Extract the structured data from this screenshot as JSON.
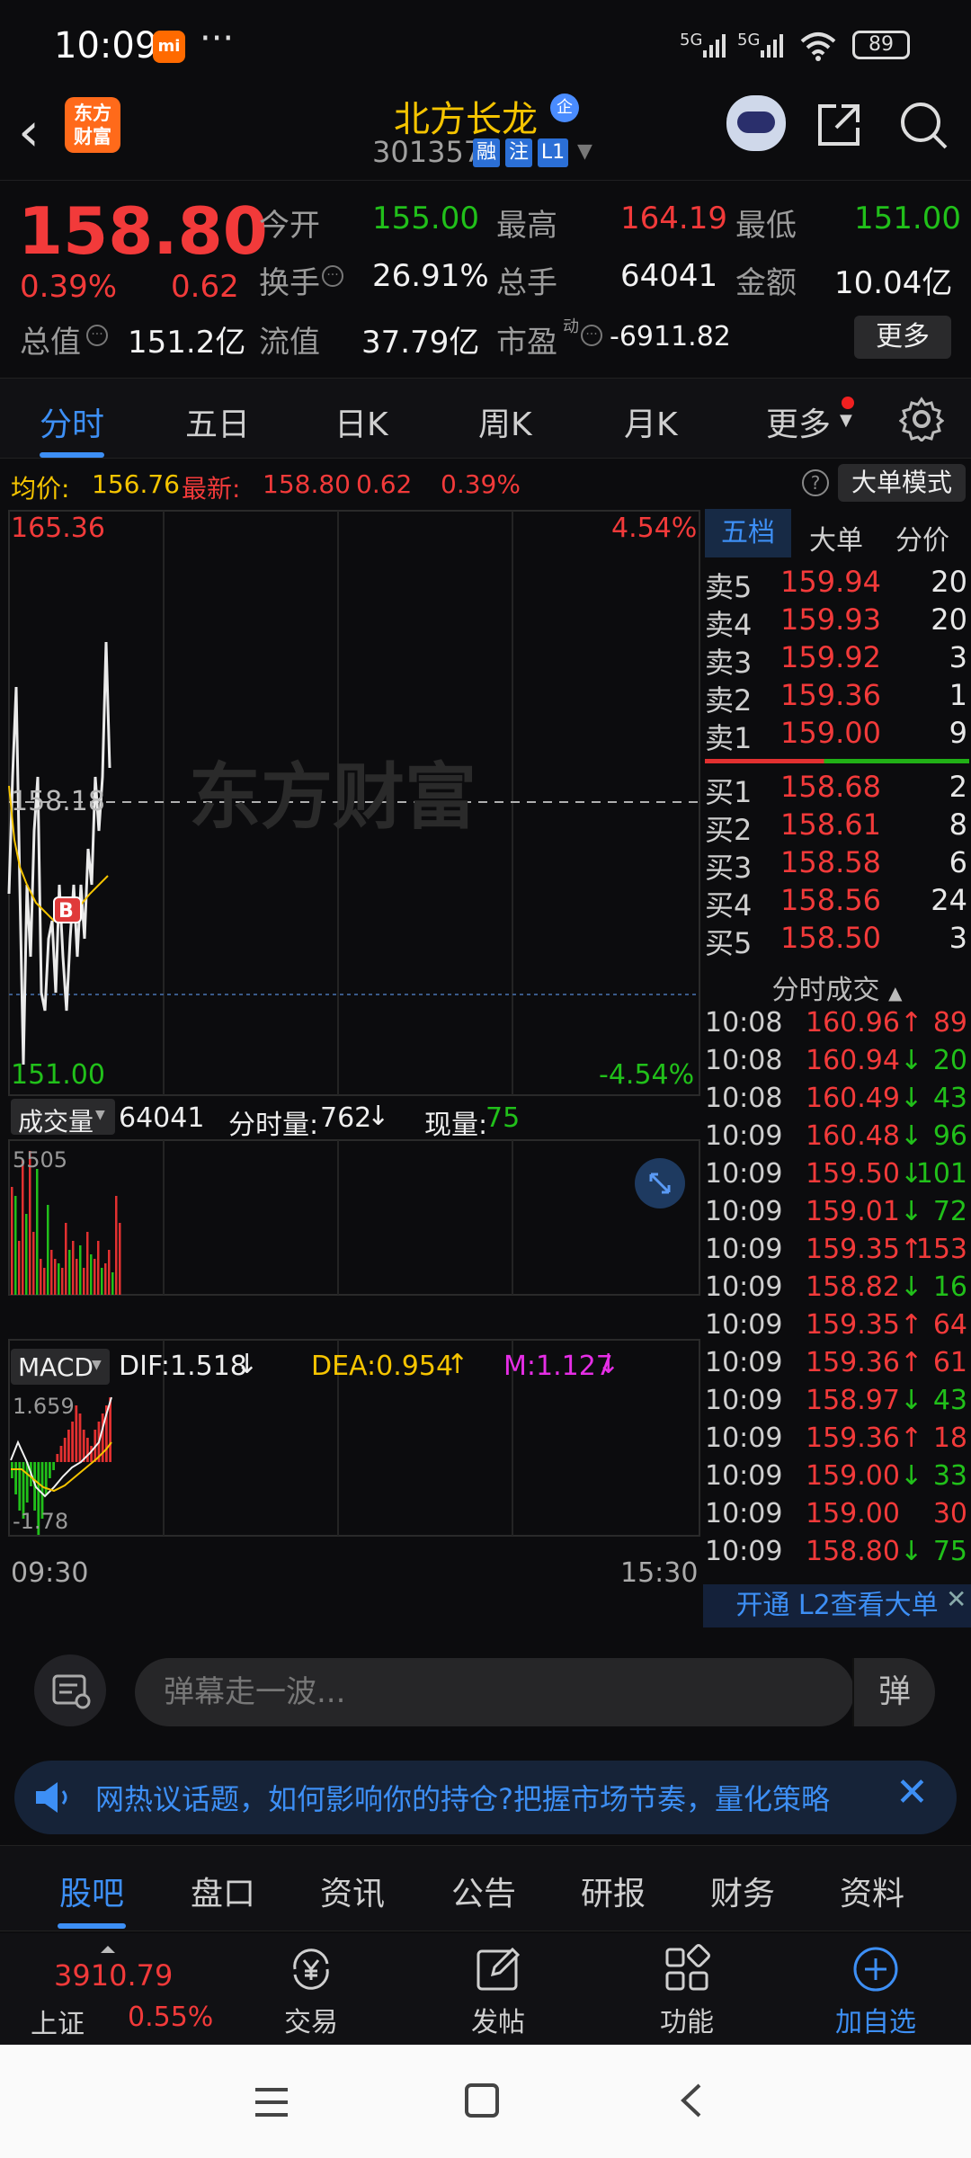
{
  "status_bar": {
    "time": "10:09",
    "more": "···",
    "signal1": "5G",
    "signal2": "5G",
    "battery": "89"
  },
  "header": {
    "logo_line1": "东方",
    "logo_line2": "财富",
    "title": "北方长龙",
    "title_badge": "企",
    "code": "301357",
    "tags": [
      "融",
      "注",
      "L1"
    ]
  },
  "quote": {
    "price": "158.80",
    "change_pct": "0.39%",
    "change": "0.62",
    "open_label": "今开",
    "open": "155.00",
    "high_label": "最高",
    "high": "164.19",
    "low_label": "最低",
    "low": "151.00",
    "turnover_label": "换手",
    "turnover": "26.91%",
    "volume_label": "总手",
    "volume": "64041",
    "amount_label": "金额",
    "amount": "10.04亿",
    "mktcap_label": "总值",
    "mktcap": "151.2亿",
    "float_label": "流值",
    "float": "37.79亿",
    "pe_label": "市盈",
    "pe_sup": "动",
    "pe": "-6911.82",
    "more_button": "更多"
  },
  "tabs": [
    "分时",
    "五日",
    "日K",
    "周K",
    "月K",
    "更多"
  ],
  "info_bar": {
    "avg_label": "均价:",
    "avg": "156.76",
    "latest_label": "最新:",
    "latest": "158.80",
    "chg": "0.62",
    "chg_pct": "0.39%",
    "help": "?",
    "big_mode": "大单模式"
  },
  "chart": {
    "y_max": "165.36",
    "y_max_pct": "4.54%",
    "y_mid": "158.18",
    "y_min": "151.00",
    "y_min_pct": "-4.54%",
    "watermark": "东方财富",
    "buy_marker": "B",
    "vol_label": "成交量",
    "vol_total": "64041",
    "vol_minute_label": "分时量:",
    "vol_minute": "762",
    "vol_now_label": "现量:",
    "vol_now": "75",
    "vol_max": "5505",
    "macd_label": "MACD",
    "dif": "DIF:1.518",
    "dea": "DEA:0.954",
    "m": "M:1.127",
    "macd_max": "1.659",
    "macd_min": "-1.78",
    "time_start": "09:30",
    "time_end": "15:30"
  },
  "order_book": {
    "tabs": [
      "五档",
      "大单",
      "分价"
    ],
    "asks": [
      {
        "label": "卖5",
        "price": "159.94",
        "vol": "20"
      },
      {
        "label": "卖4",
        "price": "159.93",
        "vol": "20"
      },
      {
        "label": "卖3",
        "price": "159.92",
        "vol": "3"
      },
      {
        "label": "卖2",
        "price": "159.36",
        "vol": "1"
      },
      {
        "label": "卖1",
        "price": "159.00",
        "vol": "9"
      }
    ],
    "bids": [
      {
        "label": "买1",
        "price": "158.68",
        "vol": "2"
      },
      {
        "label": "买2",
        "price": "158.61",
        "vol": "8"
      },
      {
        "label": "买3",
        "price": "158.58",
        "vol": "6"
      },
      {
        "label": "买4",
        "price": "158.56",
        "vol": "24"
      },
      {
        "label": "买5",
        "price": "158.50",
        "vol": "3"
      }
    ],
    "trades_title": "分时成交",
    "trades": [
      {
        "time": "10:08",
        "price": "160.96↑",
        "vol": "89",
        "dir": "up"
      },
      {
        "time": "10:08",
        "price": "160.94↓",
        "vol": "20",
        "dir": "down"
      },
      {
        "time": "10:08",
        "price": "160.49↓",
        "vol": "43",
        "dir": "down"
      },
      {
        "time": "10:09",
        "price": "160.48↓",
        "vol": "96",
        "dir": "down"
      },
      {
        "time": "10:09",
        "price": "159.50↓",
        "vol": "101",
        "dir": "down"
      },
      {
        "time": "10:09",
        "price": "159.01↓",
        "vol": "72",
        "dir": "down"
      },
      {
        "time": "10:09",
        "price": "159.35↑",
        "vol": "153",
        "dir": "up"
      },
      {
        "time": "10:09",
        "price": "158.82↓",
        "vol": "16",
        "dir": "down"
      },
      {
        "time": "10:09",
        "price": "159.35↑",
        "vol": "64",
        "dir": "up"
      },
      {
        "time": "10:09",
        "price": "159.36↑",
        "vol": "61",
        "dir": "up"
      },
      {
        "time": "10:09",
        "price": "158.97↓",
        "vol": "43",
        "dir": "down"
      },
      {
        "time": "10:09",
        "price": "159.36↑",
        "vol": "18",
        "dir": "up"
      },
      {
        "time": "10:09",
        "price": "159.00↓",
        "vol": "33",
        "dir": "down"
      },
      {
        "time": "10:09",
        "price": "159.00",
        "vol": "30",
        "dir": "flat"
      },
      {
        "time": "10:09",
        "price": "158.80↓",
        "vol": "75",
        "dir": "down"
      }
    ],
    "l2_banner": "开通 L2查看大单"
  },
  "danmu": {
    "placeholder": "弹幕走一波...",
    "button": "弹"
  },
  "ticker": {
    "text": "网热议话题，如何影响你的持仓?把握市场节奏，量化策略"
  },
  "sub_tabs": [
    "股吧",
    "盘口",
    "资讯",
    "公告",
    "研报",
    "财务",
    "资料"
  ],
  "bottom": {
    "index_value": "3910.79",
    "index_name": "上证",
    "index_pct": "0.55%",
    "items": [
      "交易",
      "发帖",
      "功能",
      "加自选"
    ]
  },
  "colors": {
    "up": "#f23a3a",
    "down": "#21c01a",
    "accent": "#3d8ff5",
    "brand": "#ff6a1a",
    "avg_line": "#f5c400"
  }
}
